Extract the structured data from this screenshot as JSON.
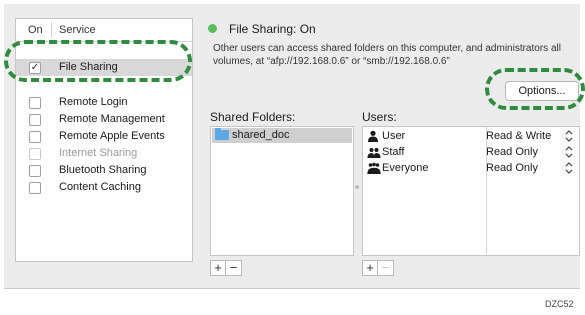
{
  "service_list": {
    "header_on": "On",
    "header_service": "Service",
    "items": [
      {
        "label": "File Sharing",
        "checked": true,
        "dim": false
      },
      {
        "label": "Remote Login",
        "checked": false,
        "dim": false
      },
      {
        "label": "Remote Management",
        "checked": false,
        "dim": false
      },
      {
        "label": "Remote Apple Events",
        "checked": false,
        "dim": false
      },
      {
        "label": "Internet Sharing",
        "checked": false,
        "dim": true
      },
      {
        "label": "Bluetooth Sharing",
        "checked": false,
        "dim": false
      },
      {
        "label": "Content Caching",
        "checked": false,
        "dim": false
      }
    ],
    "check_mark": "✓"
  },
  "status": {
    "text": "File Sharing: On",
    "color": "#5bbd5b",
    "description": "Other users can access shared folders on this computer, and administrators all volumes, at “afp://192.168.0.6” or “smb://192.168.0.6”"
  },
  "options_button": "Options...",
  "shared_folders": {
    "label": "Shared Folders:",
    "items": [
      "shared_doc"
    ],
    "add": "+",
    "remove": "−"
  },
  "users": {
    "label": "Users:",
    "items": [
      {
        "icon": "single-user-icon",
        "name": "User",
        "permission": "Read & Write"
      },
      {
        "icon": "group-icon",
        "name": "Staff",
        "permission": "Read Only"
      },
      {
        "icon": "everyone-icon",
        "name": "Everyone",
        "permission": "Read Only"
      }
    ],
    "chevron": "⌃⌄",
    "add": "+",
    "remove": "−"
  },
  "figure_ref": "DZC52",
  "callout_color": "#2f8c3c"
}
